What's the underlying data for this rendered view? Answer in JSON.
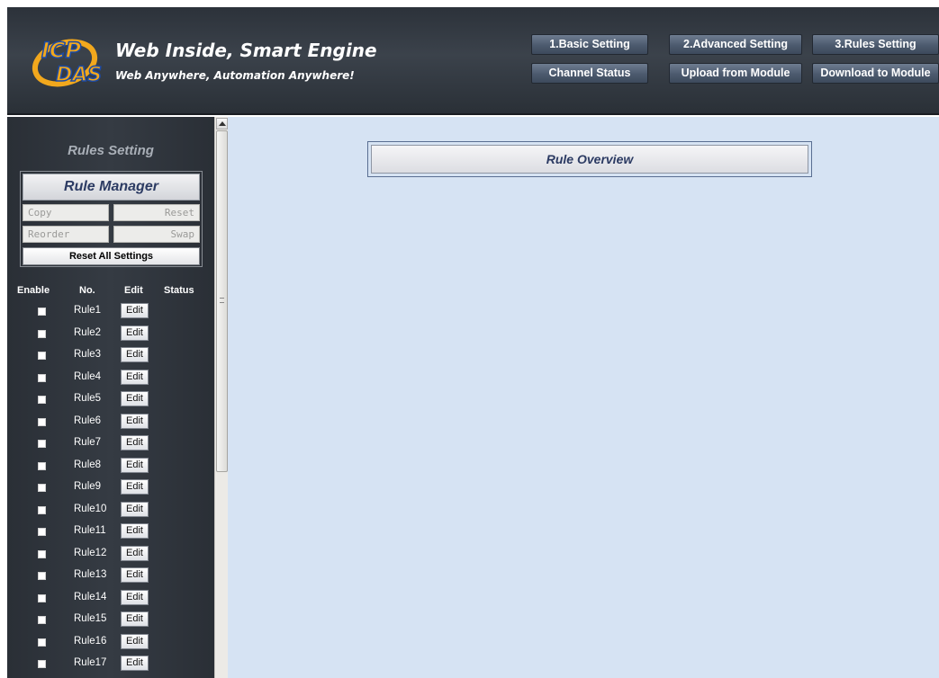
{
  "header": {
    "slogan_main": "Web Inside, Smart Engine",
    "slogan_sub": "Web Anywhere, Automation Anywhere!",
    "logo_text_top": "ICP",
    "logo_text_bottom": "DAS",
    "logo_colors": {
      "primary": "#f2a81d",
      "secondary": "#1b4aa6"
    }
  },
  "nav": {
    "basic_setting": "1.Basic Setting",
    "advanced_setting": "2.Advanced Setting",
    "rules_setting": "3.Rules Setting",
    "channel_status": "Channel Status",
    "upload_from_module": "Upload from Module",
    "download_to_module": "Download to Module"
  },
  "sidebar": {
    "title": "Rules Setting",
    "rule_manager": {
      "title": "Rule Manager",
      "copy": "Copy",
      "reset": "Reset",
      "reorder": "Reorder",
      "swap": "Swap",
      "reset_all": "Reset All Settings"
    },
    "columns": {
      "enable": "Enable",
      "no": "No.",
      "edit": "Edit",
      "status": "Status"
    },
    "rules": [
      {
        "name": "Rule1",
        "edit": "Edit",
        "enabled": false
      },
      {
        "name": "Rule2",
        "edit": "Edit",
        "enabled": false
      },
      {
        "name": "Rule3",
        "edit": "Edit",
        "enabled": false
      },
      {
        "name": "Rule4",
        "edit": "Edit",
        "enabled": false
      },
      {
        "name": "Rule5",
        "edit": "Edit",
        "enabled": false
      },
      {
        "name": "Rule6",
        "edit": "Edit",
        "enabled": false
      },
      {
        "name": "Rule7",
        "edit": "Edit",
        "enabled": false
      },
      {
        "name": "Rule8",
        "edit": "Edit",
        "enabled": false
      },
      {
        "name": "Rule9",
        "edit": "Edit",
        "enabled": false
      },
      {
        "name": "Rule10",
        "edit": "Edit",
        "enabled": false
      },
      {
        "name": "Rule11",
        "edit": "Edit",
        "enabled": false
      },
      {
        "name": "Rule12",
        "edit": "Edit",
        "enabled": false
      },
      {
        "name": "Rule13",
        "edit": "Edit",
        "enabled": false
      },
      {
        "name": "Rule14",
        "edit": "Edit",
        "enabled": false
      },
      {
        "name": "Rule15",
        "edit": "Edit",
        "enabled": false
      },
      {
        "name": "Rule16",
        "edit": "Edit",
        "enabled": false
      },
      {
        "name": "Rule17",
        "edit": "Edit",
        "enabled": false
      }
    ]
  },
  "main": {
    "overview_title": "Rule Overview"
  },
  "colors": {
    "header_bg": "#343a42",
    "sidebar_bg": "#30363d",
    "main_bg": "#d6e3f3",
    "title_text": "#2c3b63",
    "nav_button": "#55637a"
  }
}
